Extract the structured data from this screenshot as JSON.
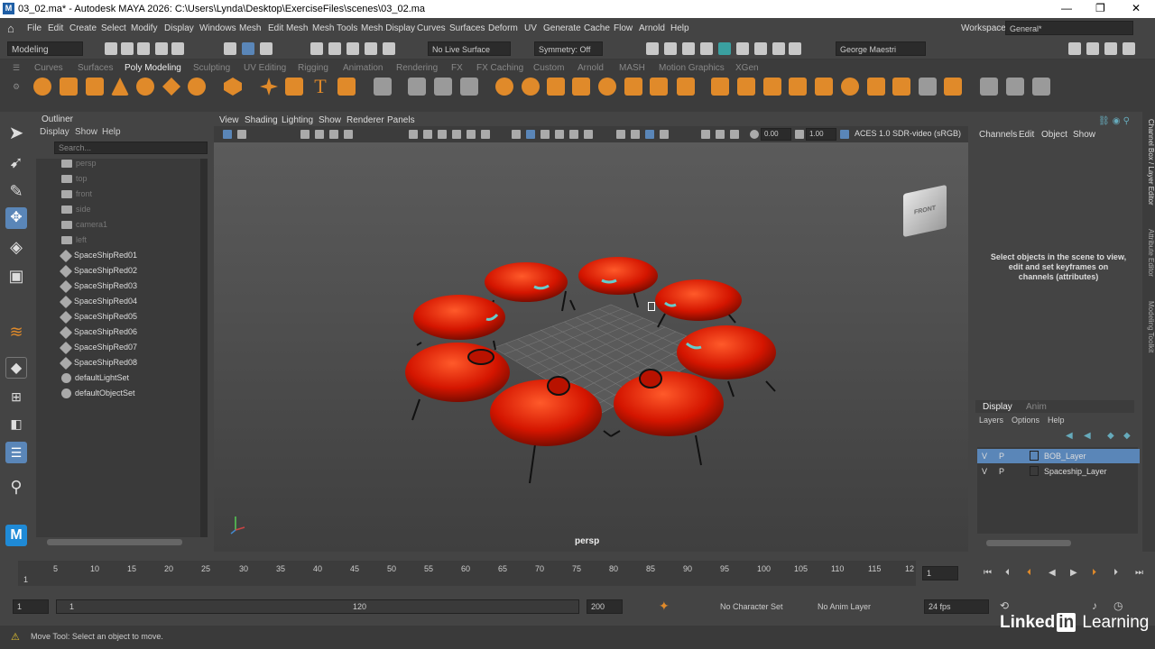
{
  "window": {
    "title": "03_02.ma* - Autodesk MAYA 2026: C:\\Users\\Lynda\\Desktop\\ExerciseFiles\\scenes\\03_02.ma",
    "logo": "M"
  },
  "menubar": {
    "items": [
      "File",
      "Edit",
      "Create",
      "Select",
      "Modify",
      "Display",
      "Windows",
      "Mesh",
      "Edit Mesh",
      "Mesh Tools",
      "Mesh Display",
      "Curves",
      "Surfaces",
      "Deform",
      "UV",
      "Generate",
      "Cache",
      "Flow",
      "Arnold",
      "Help"
    ],
    "workspace_label": "Workspace:",
    "workspace_value": "General*"
  },
  "statusline": {
    "menuset": "Modeling",
    "live_surface": "No Live Surface",
    "symmetry": "Symmetry: Off",
    "user": "George Maestri"
  },
  "shelf": {
    "tabs": [
      "Curves",
      "Surfaces",
      "Poly Modeling",
      "Sculpting",
      "UV Editing",
      "Rigging",
      "Animation",
      "Rendering",
      "FX",
      "FX Caching",
      "Custom",
      "Arnold",
      "MASH",
      "Motion Graphics",
      "XGen"
    ],
    "active_tab": "Poly Modeling"
  },
  "outliner": {
    "title": "Outliner",
    "menus": [
      "Display",
      "Show",
      "Help"
    ],
    "search_placeholder": "Search...",
    "items": [
      {
        "label": "persp",
        "type": "camera",
        "dim": true
      },
      {
        "label": "top",
        "type": "camera",
        "dim": true
      },
      {
        "label": "front",
        "type": "camera",
        "dim": true
      },
      {
        "label": "side",
        "type": "camera",
        "dim": true
      },
      {
        "label": "camera1",
        "type": "camera",
        "dim": true
      },
      {
        "label": "left",
        "type": "camera",
        "dim": true
      },
      {
        "label": "SpaceShipRed01",
        "type": "mesh",
        "dim": false
      },
      {
        "label": "SpaceShipRed02",
        "type": "mesh",
        "dim": false
      },
      {
        "label": "SpaceShipRed03",
        "type": "mesh",
        "dim": false
      },
      {
        "label": "SpaceShipRed04",
        "type": "mesh",
        "dim": false
      },
      {
        "label": "SpaceShipRed05",
        "type": "mesh",
        "dim": false
      },
      {
        "label": "SpaceShipRed06",
        "type": "mesh",
        "dim": false
      },
      {
        "label": "SpaceShipRed07",
        "type": "mesh",
        "dim": false
      },
      {
        "label": "SpaceShipRed08",
        "type": "mesh",
        "dim": false
      },
      {
        "label": "defaultLightSet",
        "type": "set",
        "dim": false
      },
      {
        "label": "defaultObjectSet",
        "type": "set",
        "dim": false
      }
    ]
  },
  "viewport": {
    "menus": [
      "View",
      "Shading",
      "Lighting",
      "Show",
      "Renderer",
      "Panels"
    ],
    "exposure": "0.00",
    "gamma": "1.00",
    "color_space": "ACES 1.0 SDR-video (sRGB)",
    "camera": "persp",
    "viewcube_face": "FRONT",
    "ship_color": "#d41500"
  },
  "channelbox": {
    "menus": [
      "Channels",
      "Edit",
      "Object",
      "Show"
    ],
    "hint": "Select objects in the scene to view, edit and set keyframes on channels (attributes)"
  },
  "layers": {
    "tabs": [
      "Display",
      "Anim"
    ],
    "menus": [
      "Layers",
      "Options",
      "Help"
    ],
    "rows": [
      {
        "v": "V",
        "p": "P",
        "name": "BOB_Layer",
        "selected": true
      },
      {
        "v": "V",
        "p": "P",
        "name": "Spaceship_Layer",
        "selected": false
      }
    ]
  },
  "sidetabs": [
    "Channel Box / Layer Editor",
    "Attribute Editor",
    "Modeling Toolkit"
  ],
  "timeslider": {
    "ticks": [
      "1",
      "5",
      "10",
      "15",
      "20",
      "25",
      "30",
      "35",
      "40",
      "45",
      "50",
      "55",
      "60",
      "65",
      "70",
      "75",
      "80",
      "85",
      "90",
      "95",
      "100",
      "105",
      "110",
      "115",
      "12"
    ],
    "current_frame": "1"
  },
  "range": {
    "start": "1",
    "playback_start": "1",
    "playback_end": "120",
    "end": "200",
    "character_set": "No Character Set",
    "anim_layer": "No Anim Layer",
    "fps": "24 fps"
  },
  "helpline": {
    "text": "Move Tool: Select an object to move."
  },
  "brand": {
    "pre": "Linked",
    "in": "in",
    "post": " Learning"
  },
  "colors": {
    "accent": "#e08a2a",
    "selected_layer": "#5a86b8",
    "panel": "#444444"
  }
}
